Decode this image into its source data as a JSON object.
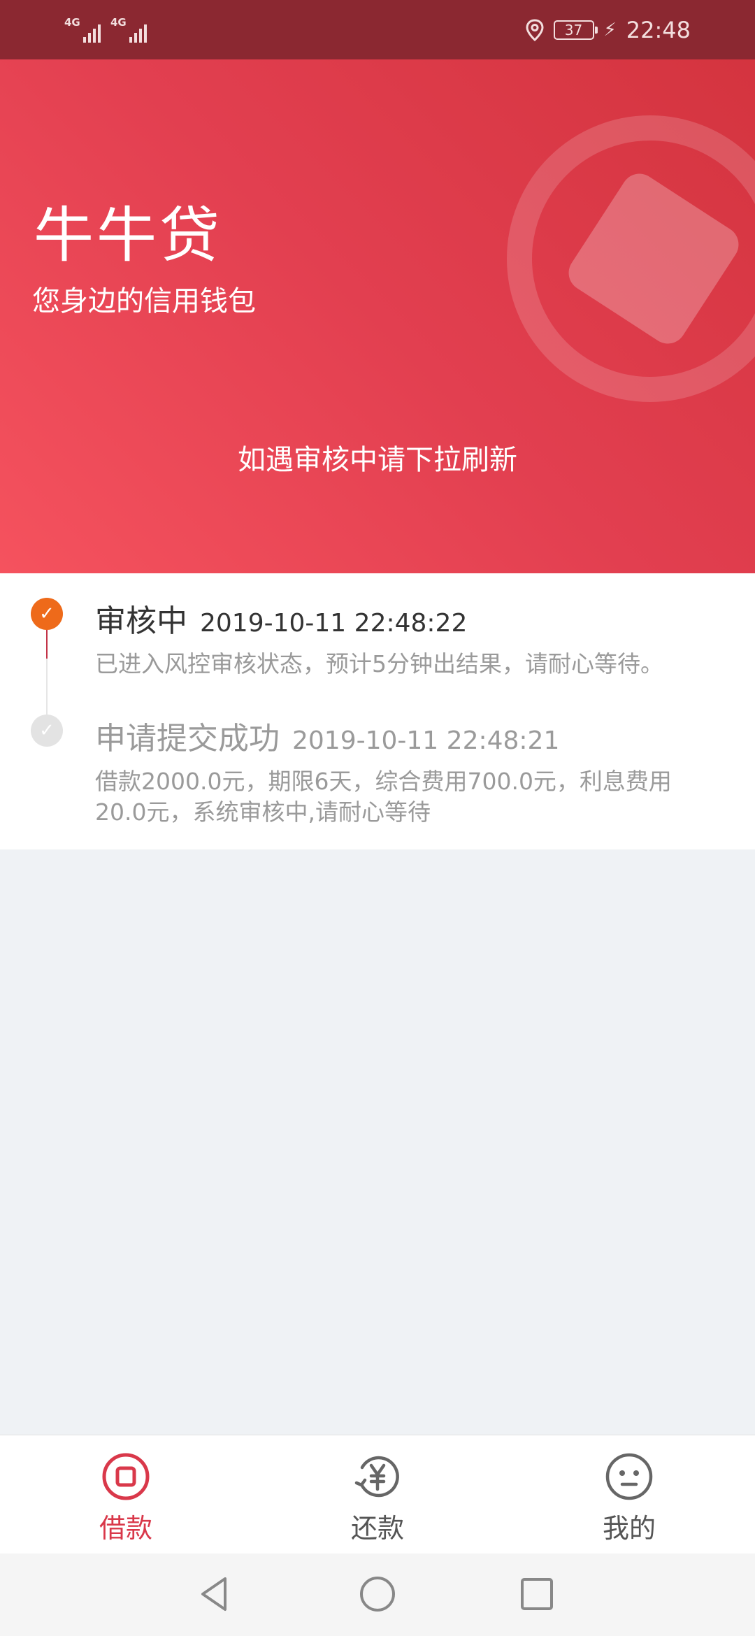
{
  "status_bar": {
    "sim1_network": "4G",
    "sim2_network": "4G",
    "battery_level": "37",
    "time": "22:48"
  },
  "hero": {
    "title": "牛牛贷",
    "subtitle": "您身边的信用钱包",
    "refresh_hint": "如遇审核中请下拉刷新"
  },
  "timeline": {
    "steps": [
      {
        "label": "审核中",
        "time": "2019-10-11 22:48:22",
        "description": "已进入风控审核状态，预计5分钟出结果，请耐心等待。",
        "active": true
      },
      {
        "label": "申请提交成功",
        "time": "2019-10-11 22:48:21",
        "description": "借款2000.0元，期限6天，综合费用700.0元，利息费用20.0元，系统审核中,请耐心等待",
        "active": false
      }
    ]
  },
  "tabs": [
    {
      "label": "借款",
      "icon": "loan-icon",
      "active": true
    },
    {
      "label": "还款",
      "icon": "repay-yen-icon",
      "active": false
    },
    {
      "label": "我的",
      "icon": "face-icon",
      "active": false
    }
  ],
  "colors": {
    "status_bar": "#8b2831",
    "brand_red": "#d9384a",
    "active_step": "#ee6a1a",
    "inactive_text": "#9a9a9a",
    "page_background": "#eff2f5"
  }
}
